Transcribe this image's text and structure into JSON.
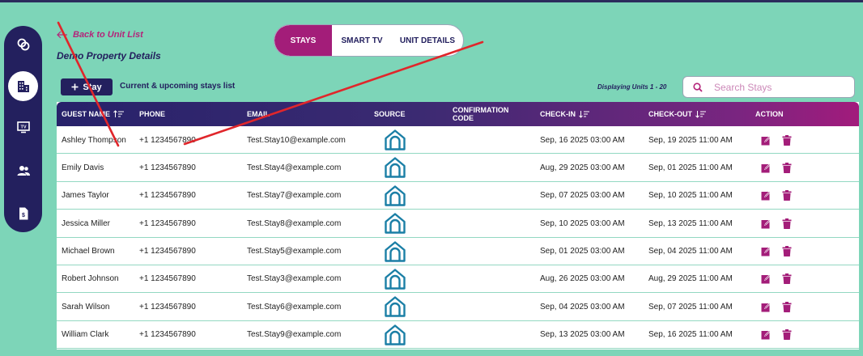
{
  "sidebar": {
    "items": [
      {
        "name": "link-icon",
        "active": false
      },
      {
        "name": "building-icon",
        "active": true
      },
      {
        "name": "tv-icon",
        "active": false
      },
      {
        "name": "users-icon",
        "active": false
      },
      {
        "name": "billing-icon",
        "active": false
      }
    ]
  },
  "header": {
    "back_label": "Back to Unit List",
    "title": "Demo Property Details"
  },
  "tabs": [
    {
      "label": "STAYS",
      "active": true
    },
    {
      "label": "SMART TV",
      "active": false
    },
    {
      "label": "UNIT DETAILS",
      "active": false
    }
  ],
  "toolbar": {
    "add_label": "Stay",
    "list_caption": "Current & upcoming stays list",
    "displaying": "Displaying Units 1 - 20",
    "search_placeholder": "Search Stays"
  },
  "table": {
    "headers": {
      "guest_name": "GUEST NAME",
      "phone": "PHONE",
      "email": "EMAIL",
      "source": "SOURCE",
      "confirmation": "CONFIRMATION CODE",
      "check_in": "CHECK-IN",
      "check_out": "CHECK-OUT",
      "action": "ACTION"
    },
    "rows": [
      {
        "name": "Ashley Thompson",
        "phone": "+1 1234567890",
        "email": "Test.Stay10@example.com",
        "code": "",
        "check_in": "Sep, 16 2025 03:00 AM",
        "check_out": "Sep, 19 2025 11:00 AM"
      },
      {
        "name": "Emily Davis",
        "phone": "+1 1234567890",
        "email": "Test.Stay4@example.com",
        "code": "",
        "check_in": "Aug, 29 2025 03:00 AM",
        "check_out": "Sep, 01 2025 11:00 AM"
      },
      {
        "name": "James Taylor",
        "phone": "+1 1234567890",
        "email": "Test.Stay7@example.com",
        "code": "",
        "check_in": "Sep, 07 2025 03:00 AM",
        "check_out": "Sep, 10 2025 11:00 AM"
      },
      {
        "name": "Jessica Miller",
        "phone": "+1 1234567890",
        "email": "Test.Stay8@example.com",
        "code": "",
        "check_in": "Sep, 10 2025 03:00 AM",
        "check_out": "Sep, 13 2025 11:00 AM"
      },
      {
        "name": "Michael Brown",
        "phone": "+1 1234567890",
        "email": "Test.Stay5@example.com",
        "code": "",
        "check_in": "Sep, 01 2025 03:00 AM",
        "check_out": "Sep, 04 2025 11:00 AM"
      },
      {
        "name": "Robert Johnson",
        "phone": "+1 1234567890",
        "email": "Test.Stay3@example.com",
        "code": "",
        "check_in": "Aug, 26 2025 03:00 AM",
        "check_out": "Aug, 29 2025 11:00 AM"
      },
      {
        "name": "Sarah Wilson",
        "phone": "+1 1234567890",
        "email": "Test.Stay6@example.com",
        "code": "",
        "check_in": "Sep, 04 2025 03:00 AM",
        "check_out": "Sep, 07 2025 11:00 AM"
      },
      {
        "name": "William Clark",
        "phone": "+1 1234567890",
        "email": "Test.Stay9@example.com",
        "code": "",
        "check_in": "Sep, 13 2025 03:00 AM",
        "check_out": "Sep, 16 2025 11:00 AM"
      }
    ]
  },
  "colors": {
    "background": "#7dd5b8",
    "navy": "#23205e",
    "magenta": "#a31d79",
    "source_icon": "#1b7fa6",
    "annotation_red": "#e0262b"
  }
}
